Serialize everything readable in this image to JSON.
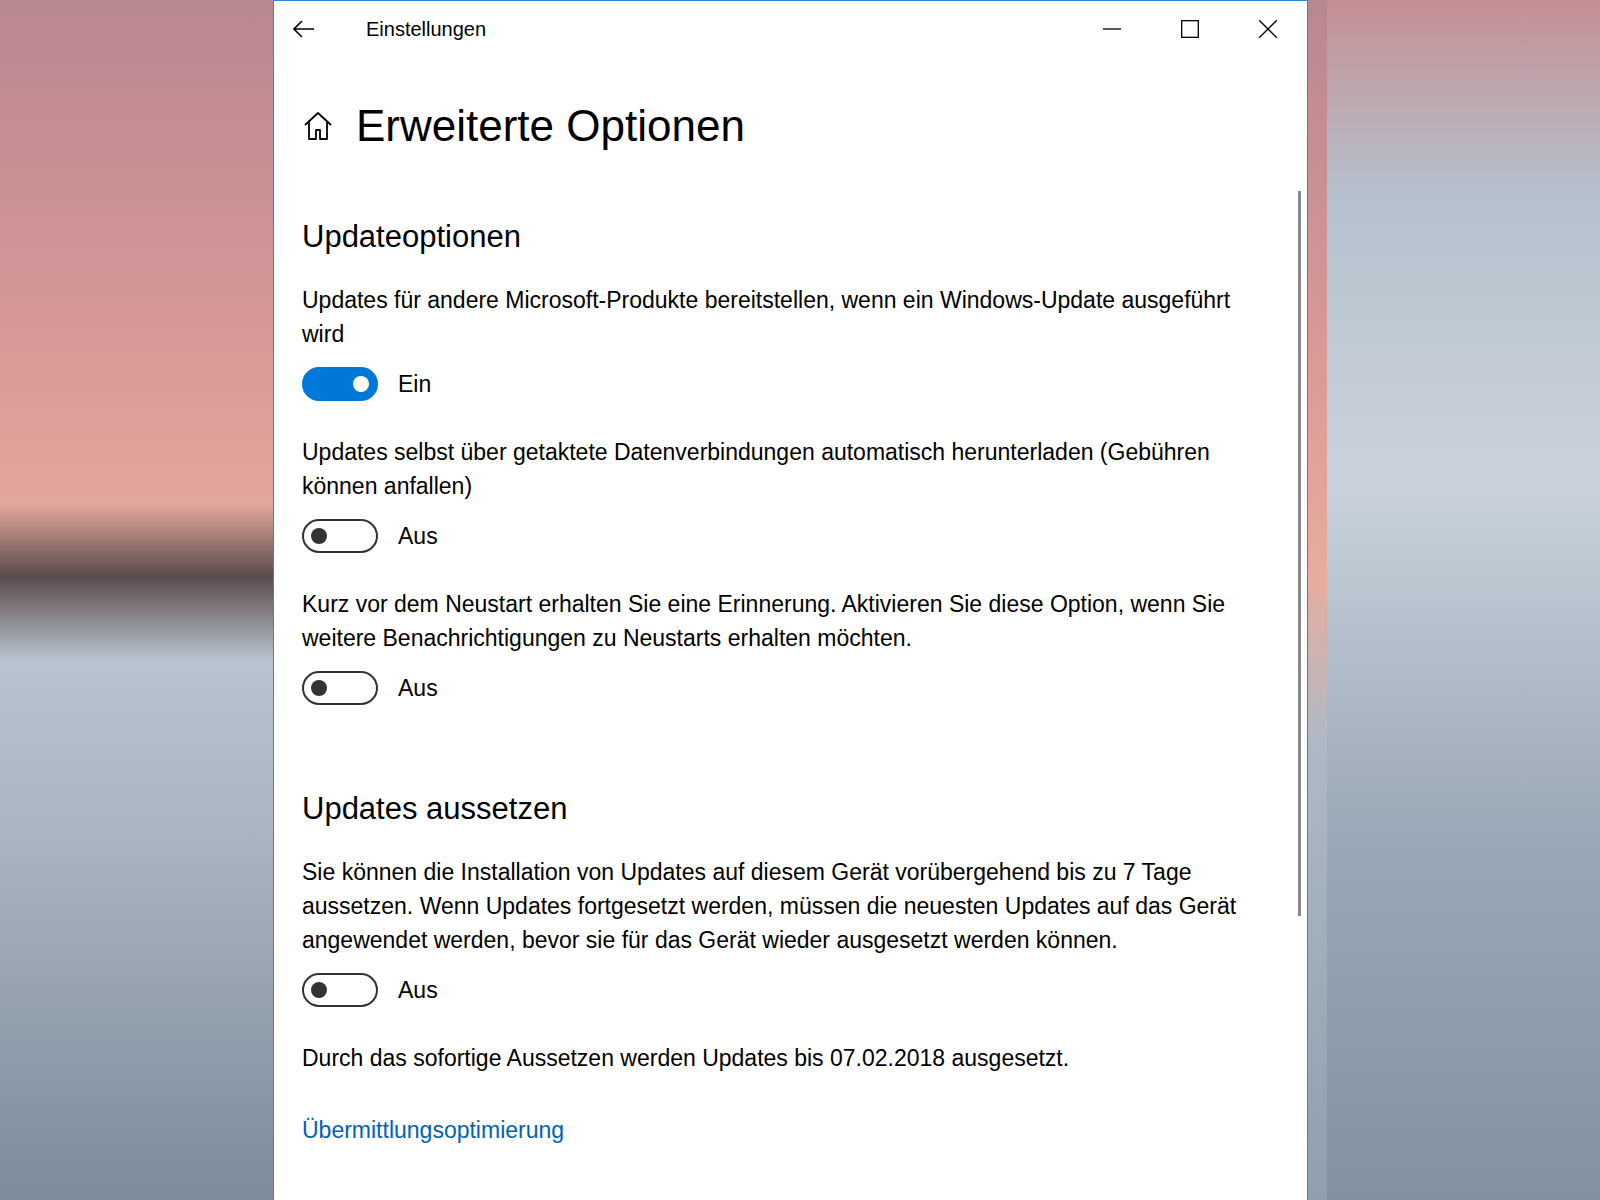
{
  "window": {
    "title": "Einstellungen"
  },
  "page": {
    "title": "Erweiterte Optionen"
  },
  "sections": [
    {
      "title": "Updateoptionen",
      "note": "",
      "options": [
        {
          "text": "Updates für andere Microsoft-Produkte bereitstellen, wenn ein Windows-Update ausgeführt wird",
          "on": true,
          "state_label": "Ein"
        },
        {
          "text": "Updates selbst über getaktete Datenverbindungen automatisch herunterladen (Gebühren können anfallen)",
          "on": false,
          "state_label": "Aus"
        },
        {
          "text": "Kurz vor dem Neustart erhalten Sie eine Erinnerung. Aktivieren Sie diese Option, wenn Sie weitere Benachrichtigungen zu Neustarts erhalten möchten.",
          "on": false,
          "state_label": "Aus"
        }
      ]
    },
    {
      "title": "Updates aussetzen",
      "note": "Durch das sofortige Aussetzen werden Updates bis 07.02.2018 ausgesetzt.",
      "options": [
        {
          "text": "Sie können die Installation von Updates auf diesem Gerät vorübergehend bis zu 7 Tage aussetzen. Wenn Updates fortgesetzt werden, müssen die neuesten Updates auf das Gerät angewendet werden, bevor sie für das Gerät wieder ausgesetzt werden können.",
          "on": false,
          "state_label": "Aus"
        }
      ]
    }
  ],
  "link": "Übermittlungsoptimierung",
  "scrollbar": {
    "level": 0.62
  }
}
